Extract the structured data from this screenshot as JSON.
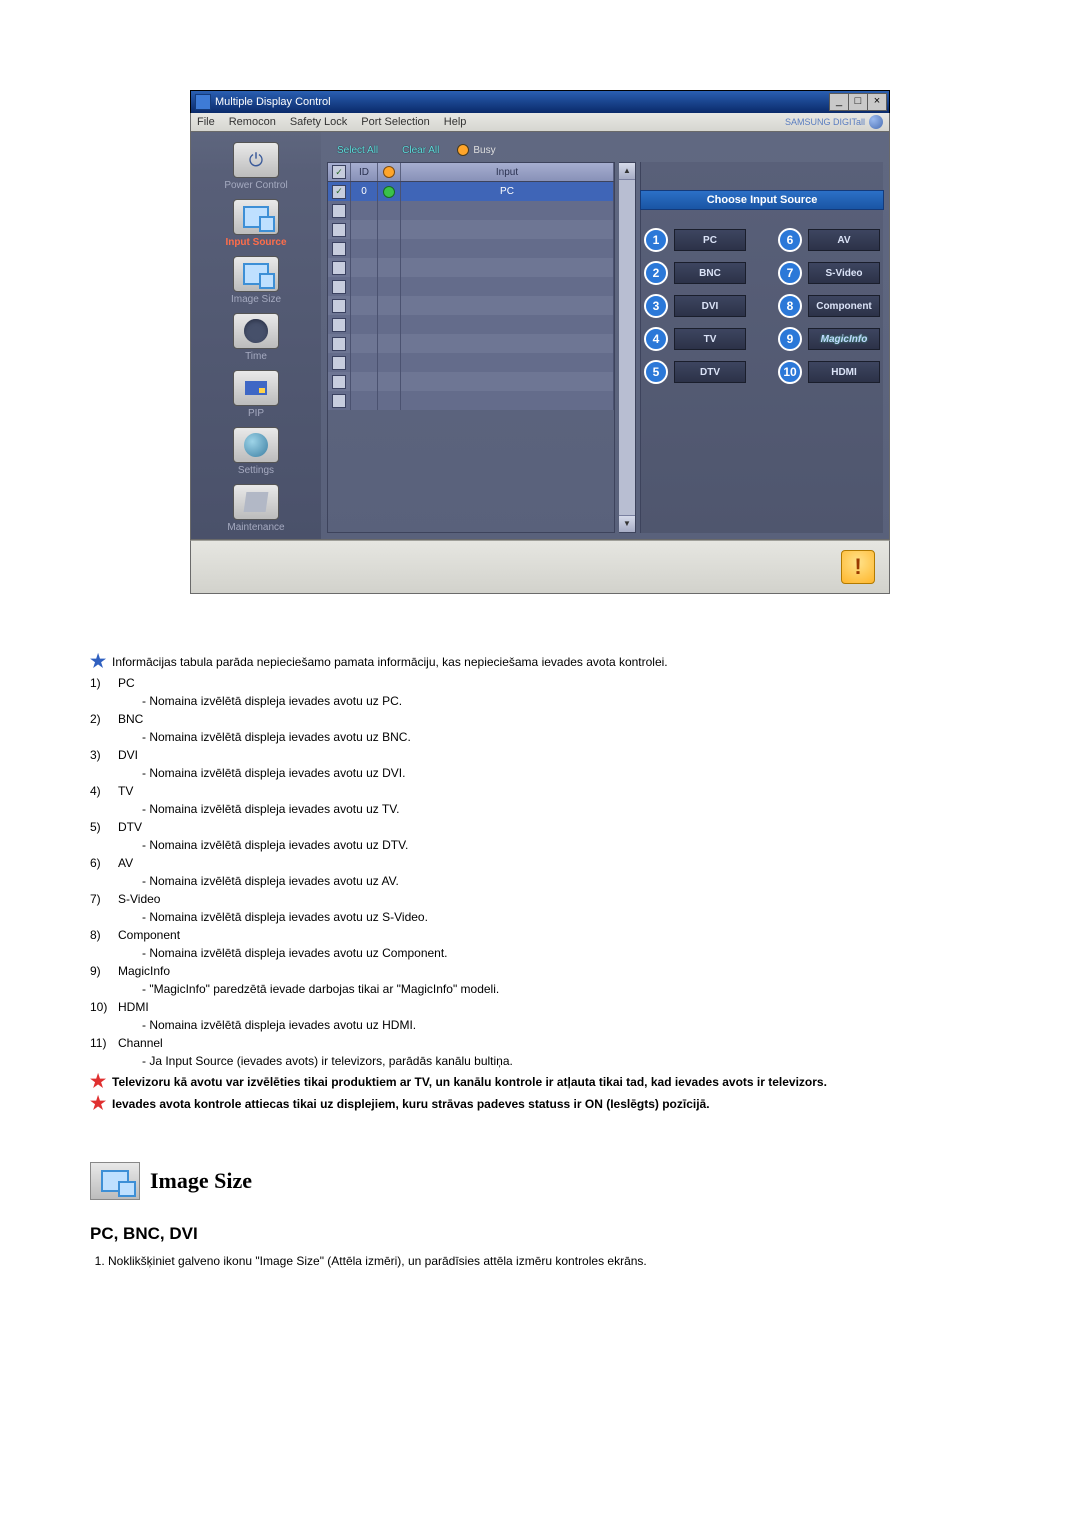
{
  "window": {
    "title": "Multiple Display Control",
    "btn_min": "_",
    "btn_max": "□",
    "btn_close": "×"
  },
  "menubar": {
    "file": "File",
    "remocon": "Remocon",
    "safety": "Safety Lock",
    "port": "Port Selection",
    "help": "Help",
    "brand": "SAMSUNG DIGITall"
  },
  "sidebar": {
    "power": "Power Control",
    "input": "Input Source",
    "image": "Image Size",
    "time": "Time",
    "pip": "PIP",
    "settings": "Settings",
    "maint": "Maintenance"
  },
  "toolbar": {
    "select_all": "Select All",
    "clear_all": "Clear All",
    "busy": "Busy"
  },
  "table": {
    "h_chk": "✓",
    "h_id": "ID",
    "h_stat": "⦿",
    "h_input": "Input",
    "row0_id": "0",
    "row0_input": "PC"
  },
  "panel": {
    "heading": "Choose Input Source",
    "left": [
      "PC",
      "BNC",
      "DVI",
      "TV",
      "DTV"
    ],
    "right": [
      "AV",
      "S-Video",
      "Component",
      "MagicInfo",
      "HDMI"
    ],
    "nums_left": [
      "1",
      "2",
      "3",
      "4",
      "5"
    ],
    "nums_right": [
      "6",
      "7",
      "8",
      "9",
      "10"
    ]
  },
  "intro": "Informācijas tabula parāda nepieciešamo pamata informāciju, kas nepieciešama ievades avota kontrolei.",
  "list": [
    {
      "n": "1)",
      "t": "PC",
      "d": "- Nomaina izvēlētā displeja ievades avotu uz PC."
    },
    {
      "n": "2)",
      "t": "BNC",
      "d": "- Nomaina izvēlētā displeja ievades avotu uz BNC."
    },
    {
      "n": "3)",
      "t": "DVI",
      "d": "- Nomaina izvēlētā displeja ievades avotu uz DVI."
    },
    {
      "n": "4)",
      "t": "TV",
      "d": "- Nomaina izvēlētā displeja ievades avotu uz TV."
    },
    {
      "n": "5)",
      "t": "DTV",
      "d": "- Nomaina izvēlētā displeja ievades avotu uz DTV."
    },
    {
      "n": "6)",
      "t": "AV",
      "d": "- Nomaina izvēlētā displeja ievades avotu uz AV."
    },
    {
      "n": "7)",
      "t": "S-Video",
      "d": "- Nomaina izvēlētā displeja ievades avotu uz S-Video."
    },
    {
      "n": "8)",
      "t": "Component",
      "d": "- Nomaina izvēlētā displeja ievades avotu uz Component."
    },
    {
      "n": "9)",
      "t": "MagicInfo",
      "d": "- \"MagicInfo\" paredzētā ievade darbojas tikai ar \"MagicInfo\" modeli."
    },
    {
      "n": "10)",
      "t": "HDMI",
      "d": "- Nomaina izvēlētā displeja ievades avotu uz HDMI."
    },
    {
      "n": "11)",
      "t": "Channel",
      "d": "- Ja Input Source (ievades avots) ir televizors, parādās kanālu bultiņa."
    }
  ],
  "notes": [
    "Televizoru kā avotu var izvēlēties tikai produktiem ar TV, un kanālu kontrole ir atļauta tikai tad, kad ievades avots ir televizors.",
    "Ievades avota kontrole attiecas tikai uz displejiem, kuru strāvas padeves statuss ir ON (Ieslēgts) pozīcijā."
  ],
  "section": {
    "title": "Image Size",
    "subhead": "PC, BNC, DVI",
    "step1": "Noklikšķiniet galveno ikonu \"Image Size\" (Attēla izmēri), un parādīsies attēla izmēru kontroles ekrāns."
  },
  "alert": "!"
}
